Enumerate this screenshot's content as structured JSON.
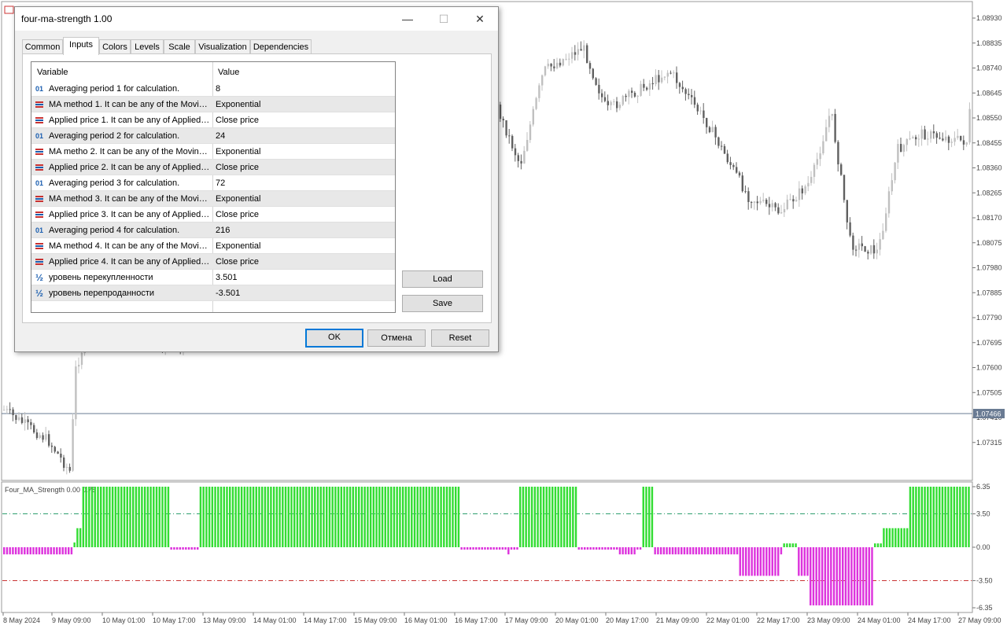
{
  "dialog": {
    "title": "four-ma-strength 1.00",
    "minimize_symbol": "—",
    "maximize_symbol": "☐",
    "close_symbol": "✕",
    "tabs": [
      "Common",
      "Inputs",
      "Colors",
      "Levels",
      "Scale",
      "Visualization",
      "Dependencies"
    ],
    "active_tab": "Inputs",
    "grid": {
      "headers": {
        "variable": "Variable",
        "value": "Value"
      },
      "rows": [
        {
          "icon": "int-icon",
          "variable": "Averaging period 1 for calculation.",
          "value": "8"
        },
        {
          "icon": "enum-icon",
          "variable": "MA method 1. It can be any of the Moving Average method enumeration values.",
          "value": "Exponential"
        },
        {
          "icon": "enum-icon",
          "variable": "Applied price 1. It can be any of Applied price enumeration values.",
          "value": "Close price"
        },
        {
          "icon": "int-icon",
          "variable": "Averaging period 2 for calculation.",
          "value": "24"
        },
        {
          "icon": "enum-icon",
          "variable": "MA metho 2. It can be any of the Moving Average method enumeration values.",
          "value": "Exponential"
        },
        {
          "icon": "enum-icon",
          "variable": "Applied price 2. It can be any of Applied price enumeration values.",
          "value": "Close price"
        },
        {
          "icon": "int-icon",
          "variable": "Averaging period 3 for calculation.",
          "value": "72"
        },
        {
          "icon": "enum-icon",
          "variable": "MA method 3. It can be any of the Moving Average method enumeration values.",
          "value": "Exponential"
        },
        {
          "icon": "enum-icon",
          "variable": "Applied price 3. It can be any of Applied price enumeration values.",
          "value": "Close price"
        },
        {
          "icon": "int-icon",
          "variable": "Averaging period 4 for calculation.",
          "value": "216"
        },
        {
          "icon": "enum-icon",
          "variable": "MA method 4. It can be any of the Moving Average method enumeration values.",
          "value": "Exponential"
        },
        {
          "icon": "enum-icon",
          "variable": "Applied price 4. It can be any of Applied price enumeration values.",
          "value": "Close price"
        },
        {
          "icon": "double-icon",
          "variable": "уровень перекупленности",
          "value": "3.501"
        },
        {
          "icon": "double-icon",
          "variable": "уровень перепроданности",
          "value": "-3.501"
        }
      ]
    },
    "buttons": {
      "load": "Load",
      "save": "Save",
      "ok": "OK",
      "cancel": "Отмена",
      "reset": "Reset"
    }
  },
  "icon_glyphs": {
    "int": "01",
    "double": "½"
  },
  "colors": {
    "bull_candle": "#c0c0c0",
    "bear_candle": "#606060",
    "hist_positive": "#33dd33",
    "hist_negative": "#dd33dd",
    "level_upper": "#2e9e6e",
    "level_lower": "#c83232",
    "price_line": "#6a7b93",
    "price_badge": "#6a7b93"
  },
  "price_axis": {
    "labels": [
      "1.08930",
      "1.08835",
      "1.08740",
      "1.08645",
      "1.08550",
      "1.08455",
      "1.08360",
      "1.08265",
      "1.08170",
      "1.08075",
      "1.07980",
      "1.07885",
      "1.07790",
      "1.07695",
      "1.07600",
      "1.07505",
      "1.07410",
      "1.07315"
    ],
    "current_price": "1.07466"
  },
  "indicator": {
    "label": "Four_MA_Strength 0.00 0.75",
    "axis_labels": [
      "6.35",
      "3.50",
      "0.00",
      "-3.50",
      "-6.35"
    ],
    "range": [
      -6.35,
      6.35
    ],
    "levels": [
      3.5,
      -3.5
    ]
  },
  "time_axis": {
    "labels": [
      "8 May 2024",
      "9 May 09:00",
      "10 May 01:00",
      "10 May 17:00",
      "13 May 09:00",
      "14 May 01:00",
      "14 May 17:00",
      "15 May 09:00",
      "16 May 01:00",
      "16 May 17:00",
      "17 May 09:00",
      "20 May 01:00",
      "20 May 17:00",
      "21 May 09:00",
      "22 May 01:00",
      "22 May 17:00",
      "23 May 09:00",
      "24 May 01:00",
      "24 May 17:00",
      "27 May 09:00"
    ]
  },
  "chart_data": {
    "type": "bar",
    "title": "Four_MA_Strength 0.00 0.75",
    "ylim": [
      -6.35,
      6.35
    ],
    "series": [
      {
        "values": [
          -0.75,
          -0.75,
          -0.75,
          -0.75,
          -0.75,
          -0.75,
          -0.75,
          -0.75,
          -0.75,
          -0.75,
          -0.75,
          -0.75,
          -0.75,
          -0.75,
          -0.75,
          -0.75,
          -0.75,
          -0.75,
          -0.75,
          -0.75,
          -0.75,
          -0.75,
          -0.75,
          -0.75,
          0.5,
          2.0,
          2.0,
          6.35,
          6.35,
          6.35,
          6.35,
          6.35,
          6.35,
          6.35,
          6.35,
          6.35,
          6.35,
          6.35,
          6.35,
          6.35,
          6.35,
          6.35,
          6.35,
          6.35,
          6.35,
          6.35,
          6.35,
          6.35,
          6.35,
          6.35,
          6.35,
          6.35,
          6.35,
          6.35,
          6.35,
          6.35,
          6.35,
          -0.25,
          -0.25,
          -0.25,
          -0.25,
          -0.25,
          -0.25,
          -0.25,
          -0.25,
          -0.25,
          -0.25,
          6.35,
          6.35,
          6.35,
          6.35,
          6.35,
          6.35,
          6.35,
          6.35,
          6.35,
          6.35,
          6.35,
          6.35,
          6.35,
          6.35,
          6.35,
          6.35,
          6.35,
          6.35,
          6.35,
          6.35,
          6.35,
          6.35,
          6.35,
          6.35,
          6.35,
          6.35,
          6.35,
          6.35,
          6.35,
          6.35,
          6.35,
          6.35,
          6.35,
          6.35,
          6.35,
          6.35,
          6.35,
          6.35,
          6.35,
          6.35,
          6.35,
          6.35,
          6.35,
          6.35,
          6.35,
          6.35,
          6.35,
          6.35,
          6.35,
          6.35,
          6.35,
          6.35,
          6.35,
          6.35,
          6.35,
          6.35,
          6.35,
          6.35,
          6.35,
          6.35,
          6.35,
          6.35,
          6.35,
          6.35,
          6.35,
          6.35,
          6.35,
          6.35,
          6.35,
          6.35,
          6.35,
          6.35,
          6.35,
          6.35,
          6.35,
          6.35,
          6.35,
          6.35,
          6.35,
          6.35,
          6.35,
          6.35,
          6.35,
          6.35,
          6.35,
          6.35,
          6.35,
          6.35,
          6.35,
          -0.25,
          -0.25,
          -0.25,
          -0.25,
          -0.25,
          -0.25,
          -0.25,
          -0.25,
          -0.25,
          -0.25,
          -0.25,
          -0.25,
          -0.25,
          -0.25,
          -0.25,
          -0.25,
          -0.75,
          -0.25,
          -0.25,
          -0.25,
          6.35,
          6.35,
          6.35,
          6.35,
          6.35,
          6.35,
          6.35,
          6.35,
          6.35,
          6.35,
          6.35,
          6.35,
          6.35,
          6.35,
          6.35,
          6.35,
          6.35,
          6.35,
          6.35,
          6.35,
          -0.25,
          -0.25,
          -0.25,
          -0.25,
          -0.25,
          -0.25,
          -0.25,
          -0.25,
          -0.25,
          -0.25,
          -0.25,
          -0.25,
          -0.25,
          -0.25,
          -0.75,
          -0.75,
          -0.75,
          -0.75,
          -0.75,
          -0.75,
          -0.25,
          -0.25,
          6.35,
          6.35,
          6.35,
          6.35,
          -0.75,
          -0.75,
          -0.75,
          -0.75,
          -0.75,
          -0.75,
          -0.75,
          -0.75,
          -0.75,
          -0.75,
          -0.75,
          -0.75,
          -0.75,
          -0.75,
          -0.75,
          -0.75,
          -0.75,
          -0.75,
          -0.75,
          -0.75,
          -0.75,
          -0.75,
          -0.75,
          -0.75,
          -0.75,
          -0.75,
          -0.75,
          -0.75,
          -0.75,
          -3.0,
          -3.0,
          -3.0,
          -3.0,
          -3.0,
          -3.0,
          -3.0,
          -3.0,
          -3.0,
          -3.0,
          -3.0,
          -3.0,
          -3.0,
          -3.0,
          -0.75,
          0.4,
          0.4,
          0.4,
          0.4,
          0.4,
          -3.0,
          -3.0,
          -3.0,
          -3.0,
          -6.1,
          -6.1,
          -6.1,
          -6.1,
          -6.1,
          -6.1,
          -6.1,
          -6.1,
          -6.1,
          -6.1,
          -6.1,
          -6.1,
          -6.1,
          -6.1,
          -6.1,
          -6.1,
          -6.1,
          -6.1,
          -6.1,
          -6.1,
          -6.1,
          -6.1,
          0.4,
          0.4,
          0.4,
          2.0,
          2.0,
          2.0,
          2.0,
          2.0,
          2.0,
          2.0,
          2.0,
          2.0,
          6.35,
          6.35,
          6.35,
          6.35,
          6.35,
          6.35,
          6.35,
          6.35,
          6.35,
          6.35,
          6.35,
          6.35,
          6.35,
          6.35,
          6.35,
          6.35,
          6.35,
          6.35,
          6.35,
          6.35,
          6.35
        ]
      }
    ]
  }
}
